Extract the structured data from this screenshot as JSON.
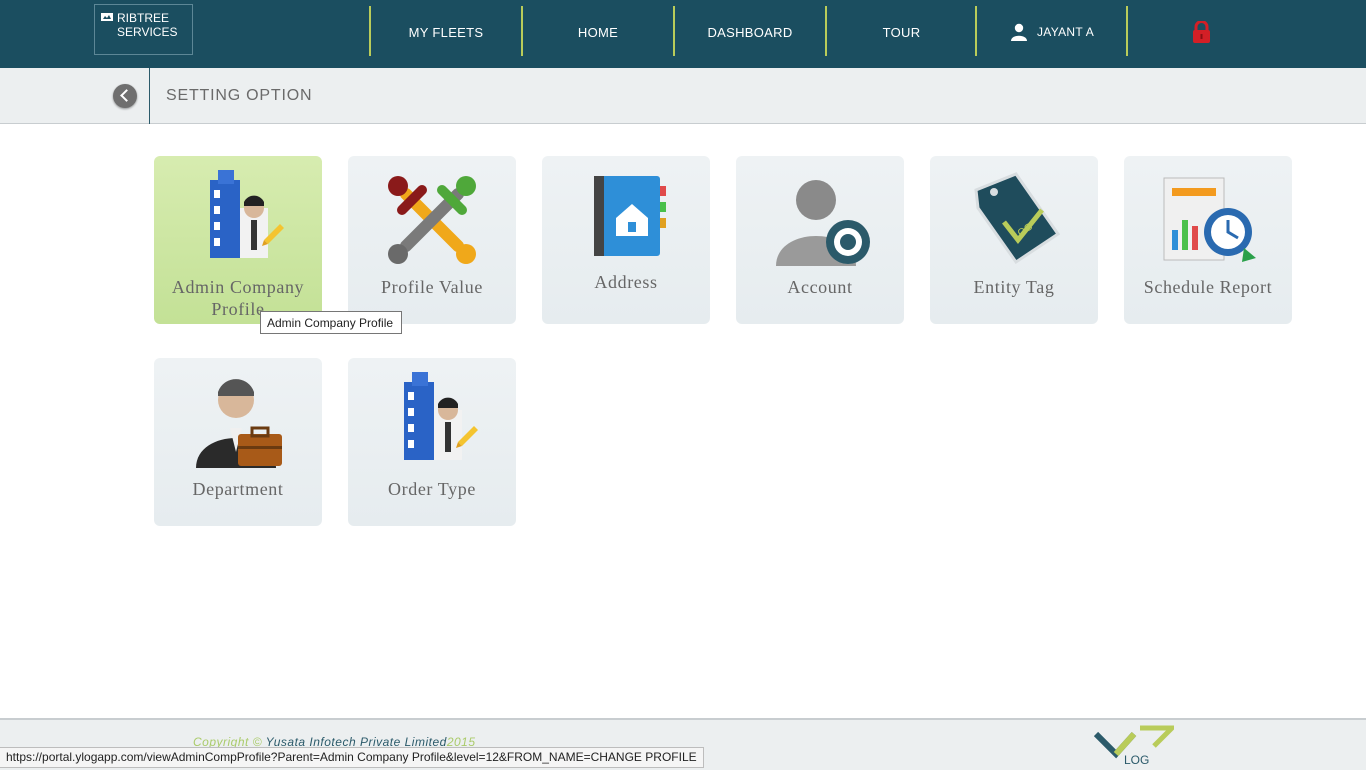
{
  "header": {
    "brand": {
      "line1": "RIBTREE",
      "line2": "SERVICES"
    },
    "nav": [
      {
        "label": "MY FLEETS"
      },
      {
        "label": "HOME"
      },
      {
        "label": "DASHBOARD"
      },
      {
        "label": "TOUR"
      },
      {
        "label": "JAYANT A"
      }
    ],
    "accent_color": "#b9cc5a",
    "bar_color": "#1b4e60"
  },
  "subheader": {
    "title": "SETTING OPTION"
  },
  "tiles": [
    {
      "label": "Admin Company Profile",
      "icon": "admin-company-profile-icon",
      "active": true
    },
    {
      "label": "Profile Value",
      "icon": "profile-value-icon"
    },
    {
      "label": "Address",
      "icon": "address-book-icon"
    },
    {
      "label": "Account",
      "icon": "account-icon"
    },
    {
      "label": "Entity Tag",
      "icon": "entity-tag-icon"
    },
    {
      "label": "Schedule Report",
      "icon": "schedule-report-icon"
    },
    {
      "label": "Department",
      "icon": "department-icon"
    },
    {
      "label": "Order Type",
      "icon": "order-type-icon"
    }
  ],
  "tooltip": "Admin Company Profile",
  "footer": {
    "copyright_prefix": "Copyright ©",
    "company": "Yusata Infotech Private Limited",
    "year": "2015",
    "logo_text": "LOG"
  },
  "status_url": "https://portal.ylogapp.com/viewAdminCompProfile?Parent=Admin Company Profile&level=12&FROM_NAME=CHANGE PROFILE"
}
